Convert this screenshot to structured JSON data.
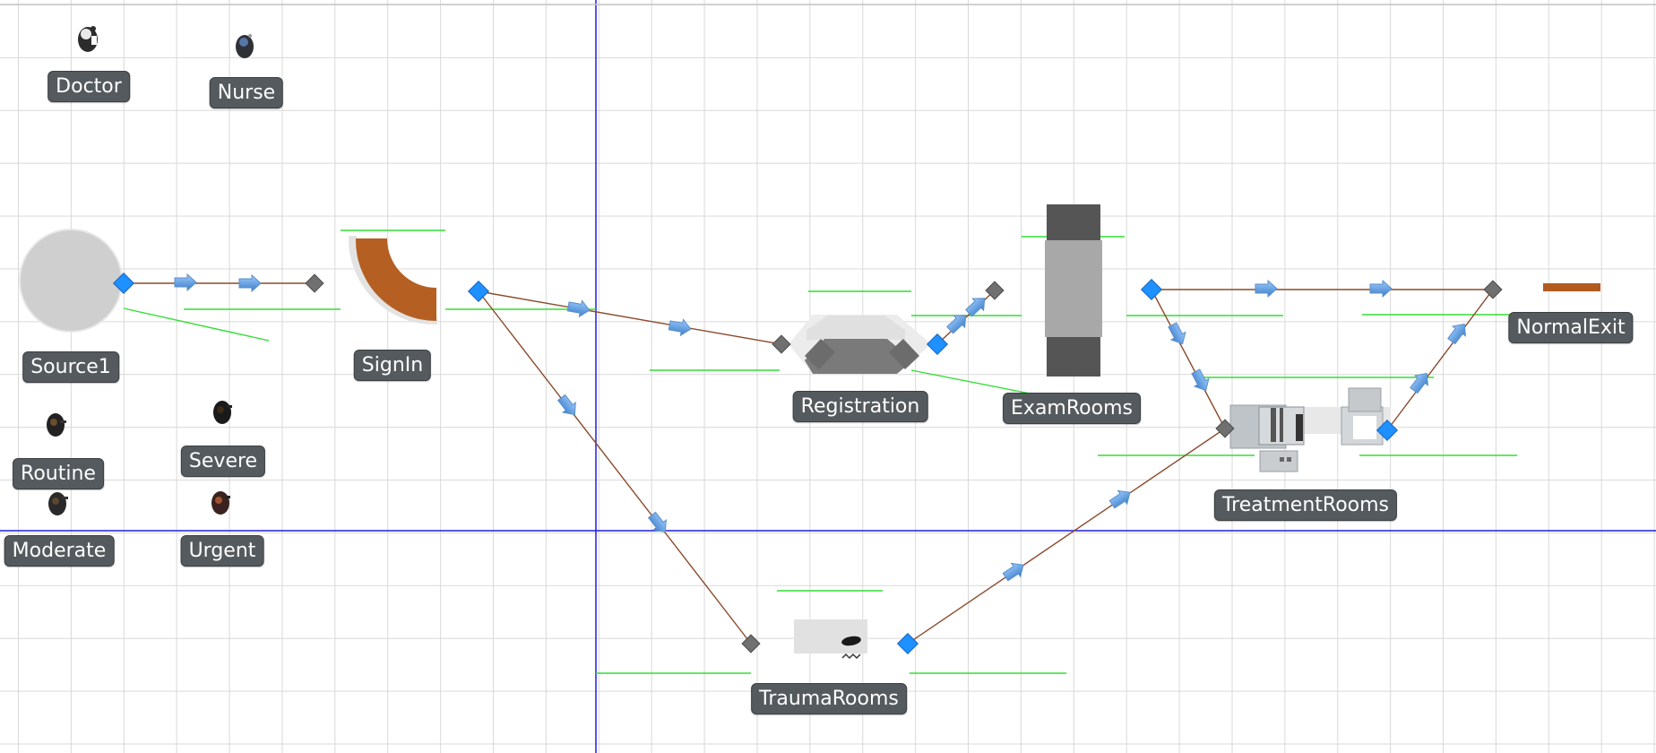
{
  "model": {
    "objects": {
      "doctor": "Doctor",
      "nurse": "Nurse",
      "source1": "Source1",
      "signin": "SignIn",
      "registration": "Registration",
      "examrooms": "ExamRooms",
      "normalexit": "NormalExit",
      "treatmentrooms": "TreatmentRooms",
      "traumarooms": "TraumaRooms",
      "routine": "Routine",
      "severe": "Severe",
      "moderate": "Moderate",
      "urgent": "Urgent"
    },
    "colors": {
      "grid": "#d9d9d9",
      "axis": "#1f1fe0",
      "path": "#8b4a2b",
      "status_line": "#33dd33",
      "input_node": "#1e90ff",
      "output_node": "#707070",
      "label_bg": "#555a5e"
    },
    "icons": {
      "entity_figure": "person-icon",
      "direction_arrow": "flow-arrow-icon"
    }
  }
}
